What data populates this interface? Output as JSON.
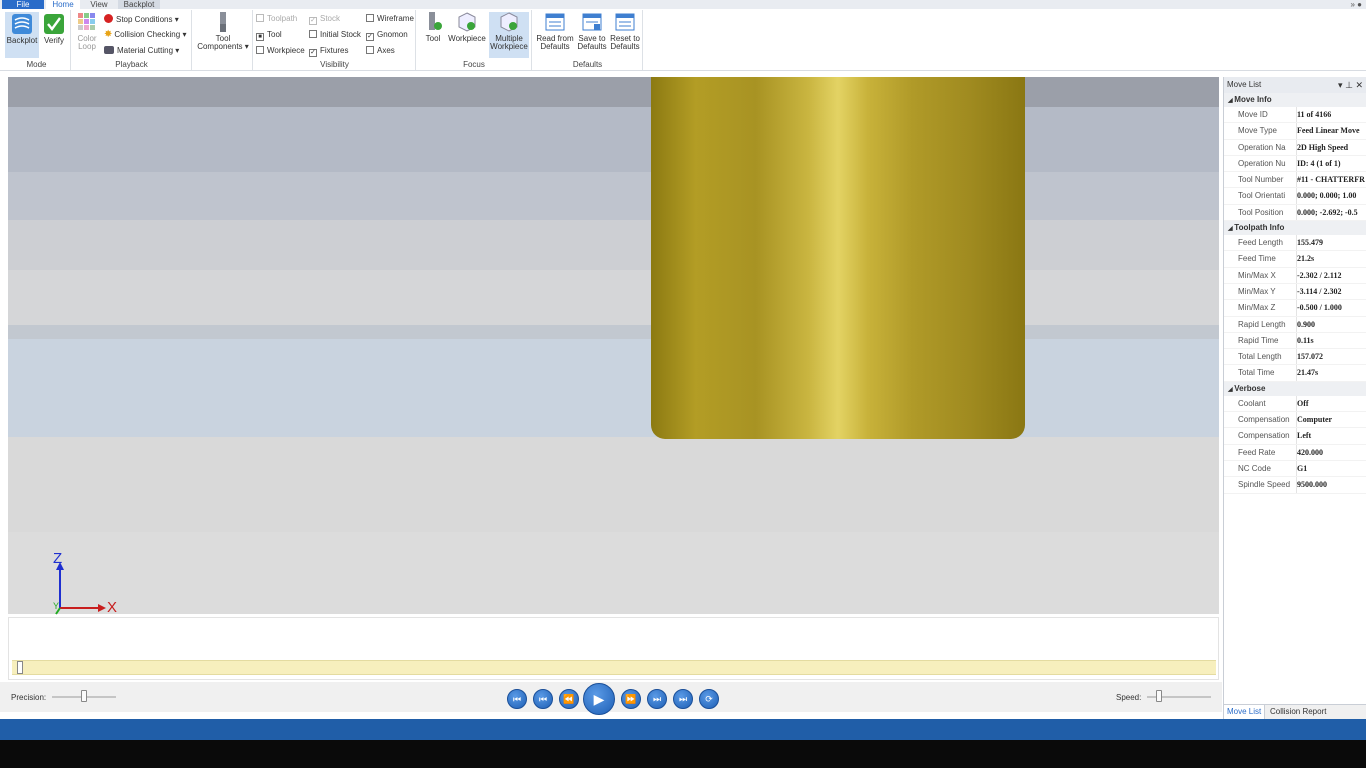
{
  "tabs": {
    "file": "File",
    "home": "Home",
    "view": "View",
    "backplot": "Backplot"
  },
  "window_controls": "» ●",
  "ribbon": {
    "mode": {
      "label": "Mode",
      "backplot": "Backplot",
      "verify": "Verify"
    },
    "playback": {
      "label": "Playback",
      "color_loop": [
        "Color",
        "Loop"
      ],
      "stop_conditions": "Stop Conditions",
      "collision_checking": "Collision Checking",
      "material_cutting": "Material Cutting"
    },
    "tool_components": [
      "Tool",
      "Components"
    ],
    "visibility": {
      "label": "Visibility",
      "toolpath": "Toolpath",
      "stock": "Stock",
      "wireframe": "Wireframe",
      "tool": "Tool",
      "initial_stock": "Initial Stock",
      "gnomon": "Gnomon",
      "workpiece": "Workpiece",
      "fixtures": "Fixtures",
      "axes": "Axes"
    },
    "focus": {
      "label": "Focus",
      "tool": "Tool",
      "workpiece": "Workpiece",
      "multiple_workpiece": [
        "Multiple",
        "Workpiece"
      ]
    },
    "defaults": {
      "label": "Defaults",
      "read": [
        "Read from",
        "Defaults"
      ],
      "save": [
        "Save to",
        "Defaults"
      ],
      "reset": [
        "Reset to",
        "Defaults"
      ]
    }
  },
  "gnomon": {
    "z": "Z",
    "y": "Y",
    "x": "X"
  },
  "timeline": {
    "progress": 0.0026,
    "current": 11,
    "total": 4166
  },
  "controls": {
    "precision_label": "Precision:",
    "speed_label": "Speed:",
    "precision_level": 0.5,
    "speed_level": 0.15
  },
  "panel": {
    "title": "Move List",
    "sections": [
      {
        "title": "Move Info",
        "rows": [
          {
            "k": "Move ID",
            "v": "11 of 4166"
          },
          {
            "k": "Move Type",
            "v": "Feed Linear Move"
          },
          {
            "k": "Operation Na",
            "v": "2D High Speed"
          },
          {
            "k": "Operation Nu",
            "v": "ID: 4 (1 of 1)"
          },
          {
            "k": "Tool Number",
            "v": "#11 - CHATTERFR"
          },
          {
            "k": "Tool Orientati",
            "v": "0.000; 0.000; 1.00"
          },
          {
            "k": "Tool Position",
            "v": "0.000; -2.692; -0.5"
          }
        ]
      },
      {
        "title": "Toolpath Info",
        "rows": [
          {
            "k": "Feed Length",
            "v": "155.479"
          },
          {
            "k": "Feed Time",
            "v": "21.2s"
          },
          {
            "k": "Min/Max X",
            "v": "-2.302 / 2.112"
          },
          {
            "k": "Min/Max Y",
            "v": "-3.114 / 2.302"
          },
          {
            "k": "Min/Max Z",
            "v": "-0.500 / 1.000"
          },
          {
            "k": "Rapid Length",
            "v": "0.900"
          },
          {
            "k": "Rapid Time",
            "v": "0.11s"
          },
          {
            "k": "Total Length",
            "v": "157.072"
          },
          {
            "k": "Total Time",
            "v": "21.47s"
          }
        ]
      },
      {
        "title": "Verbose",
        "rows": [
          {
            "k": "Coolant",
            "v": "Off"
          },
          {
            "k": "Compensation",
            "v": "Computer"
          },
          {
            "k": "Compensation",
            "v": "Left"
          },
          {
            "k": "Feed Rate",
            "v": "420.000"
          },
          {
            "k": "NC Code",
            "v": "G1"
          },
          {
            "k": "Spindle Speed",
            "v": "9500.000"
          }
        ]
      }
    ],
    "tab_move_list": "Move List",
    "tab_collision": "Collision Report"
  },
  "colors": {
    "accent": "#2a6cc9",
    "status_bar": "#205ea8",
    "tool": "#b5a12a",
    "timeline": "#f7efbd"
  }
}
